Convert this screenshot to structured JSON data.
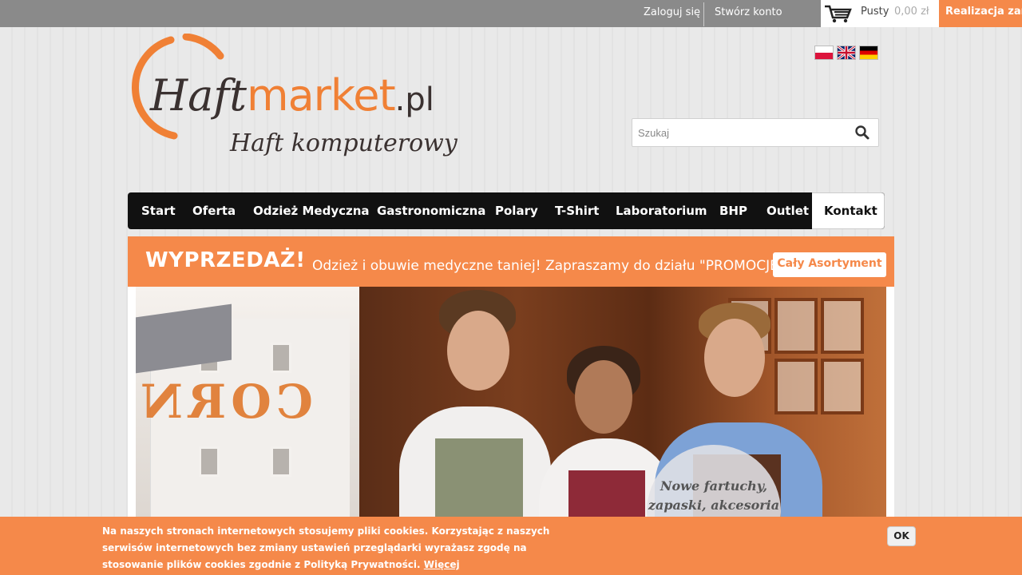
{
  "topbar": {
    "login": "Zaloguj się",
    "register": "Stwórz konto",
    "cart_status": "Pusty",
    "cart_amount": "0,00 zł",
    "checkout": "Realizacja zamówienia"
  },
  "logo": {
    "brand_h": "Haft",
    "brand_market": "market",
    "brand_pl": ".pl",
    "tagline": "Haft komputerowy"
  },
  "languages": [
    "pl",
    "en",
    "de"
  ],
  "search": {
    "placeholder": "Szukaj"
  },
  "nav": {
    "items": [
      "Start",
      "Oferta",
      "Odzież Medyczna",
      "Gastronomiczna",
      "Polary",
      "T-Shirt",
      "Laboratorium",
      "BHP",
      "Outlet",
      "Kontakt"
    ],
    "active": "Kontakt"
  },
  "promo": {
    "title": "WYPRZEDAŻ!",
    "text": "Odzież i obuwie medyczne taniej! Zapraszamy do działu \"PROMOCJE\"",
    "button": "Cały Asortyment"
  },
  "hero": {
    "badge_line1": "Nowe fartuchy,",
    "badge_line2": "zapaski, akcesoria"
  },
  "cookie": {
    "message": "Na naszych stronach internetowych stosujemy pliki cookies. Korzystając z naszych serwisów internetowych bez zmiany ustawień przeglądarki wyrażasz zgodę na stosowanie plików cookies zgodnie z Polityką Prywatności.",
    "more": "Więcej",
    "ok": "OK"
  },
  "colors": {
    "accent": "#f5894a",
    "nav_bg": "#111111",
    "topbar_bg": "#8a8a8a"
  }
}
